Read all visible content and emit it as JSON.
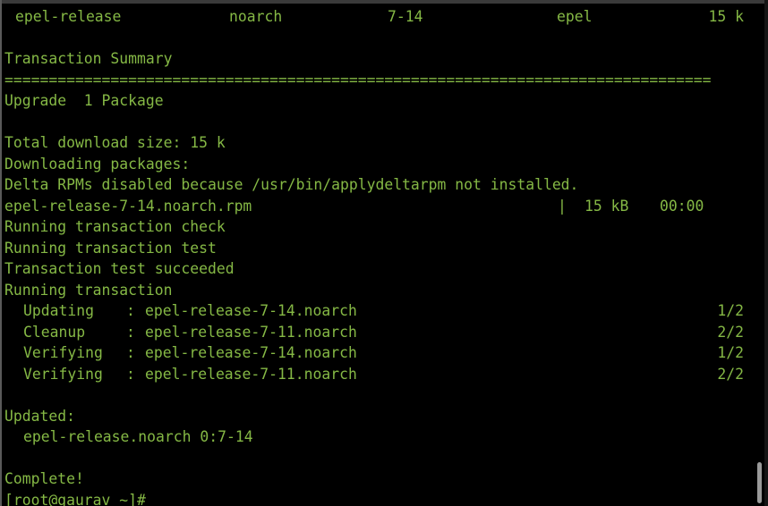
{
  "colors": {
    "background": "#000000",
    "text": "#85b845",
    "scrollbar": "#9a9a9a"
  },
  "package_row": {
    "name": "epel-release",
    "arch": "noarch",
    "version": "7-14",
    "repo": "epel",
    "size": "15 k"
  },
  "summary": {
    "title": "Transaction Summary",
    "separator": "================================================================================",
    "upgrade": "Upgrade  1 Package"
  },
  "download": {
    "total_size": "Total download size: 15 k",
    "downloading": "Downloading packages:",
    "delta_notice": "Delta RPMs disabled because /usr/bin/applydeltarpm not installed.",
    "file_name": "epel-release-7-14.noarch.rpm",
    "bar_separator": "|",
    "file_size": "15 kB",
    "file_time": "00:00"
  },
  "transaction": {
    "check": "Running transaction check",
    "test": "Running transaction test",
    "test_ok": "Transaction test succeeded",
    "running": "Running transaction",
    "steps": [
      {
        "action": "Updating",
        "package": "epel-release-7-14.noarch",
        "progress": "1/2"
      },
      {
        "action": "Cleanup",
        "package": "epel-release-7-11.noarch",
        "progress": "2/2"
      },
      {
        "action": "Verifying",
        "package": "epel-release-7-14.noarch",
        "progress": "1/2"
      },
      {
        "action": "Verifying",
        "package": "epel-release-7-11.noarch",
        "progress": "2/2"
      }
    ]
  },
  "result": {
    "updated_label": "Updated:",
    "updated_package": "epel-release.noarch 0:7-14",
    "complete": "Complete!",
    "prompt": "[root@gaurav ~]#"
  }
}
